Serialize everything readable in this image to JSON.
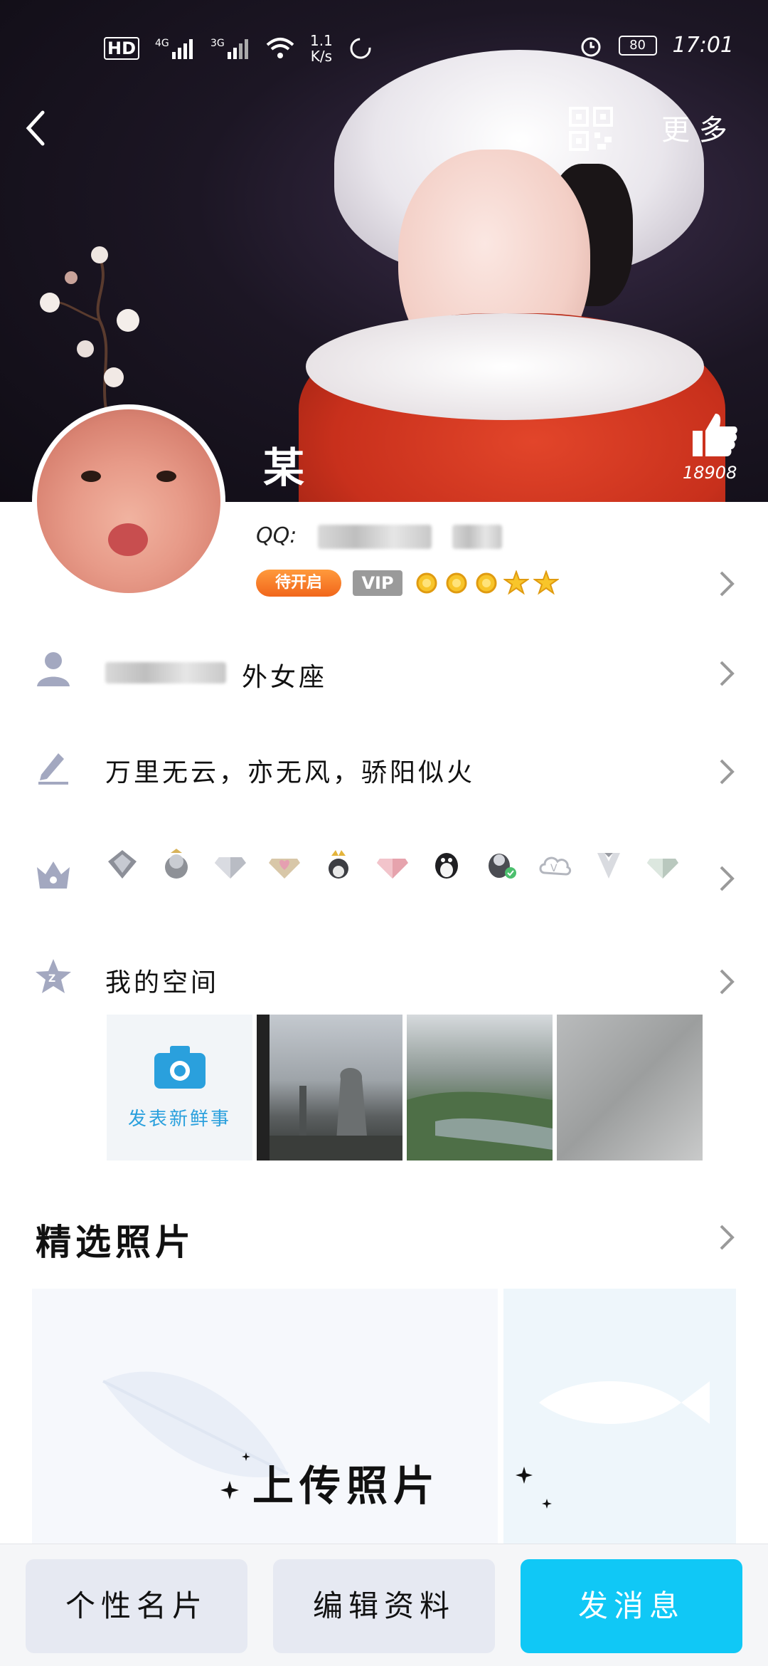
{
  "status_bar": {
    "network_speed": "1.1\nK/s",
    "network_speed_line1": "1.1",
    "network_speed_line2": "K/s",
    "battery": "80",
    "time": "17:01"
  },
  "header": {
    "more_label": "更 多",
    "name": "某",
    "like_count": "18908"
  },
  "profile": {
    "qq_label": "QQ:",
    "badge_open": "待开启",
    "badge_vip": "VIP",
    "age_info": "外女座"
  },
  "rows": {
    "signature": "万里无云，亦无风，骄阳似火",
    "space_label": "我的空间",
    "post_label": "发表新鲜事"
  },
  "photos": {
    "section_title": "精选照片",
    "upload_title": "上传照片"
  },
  "bottom_bar": {
    "card_label": "个性名片",
    "edit_label": "编辑资料",
    "message_label": "发消息"
  },
  "colors": {
    "accent": "#10c8f6",
    "badge_orange": "#f1661b",
    "vip_grey": "#9a9a9a"
  }
}
